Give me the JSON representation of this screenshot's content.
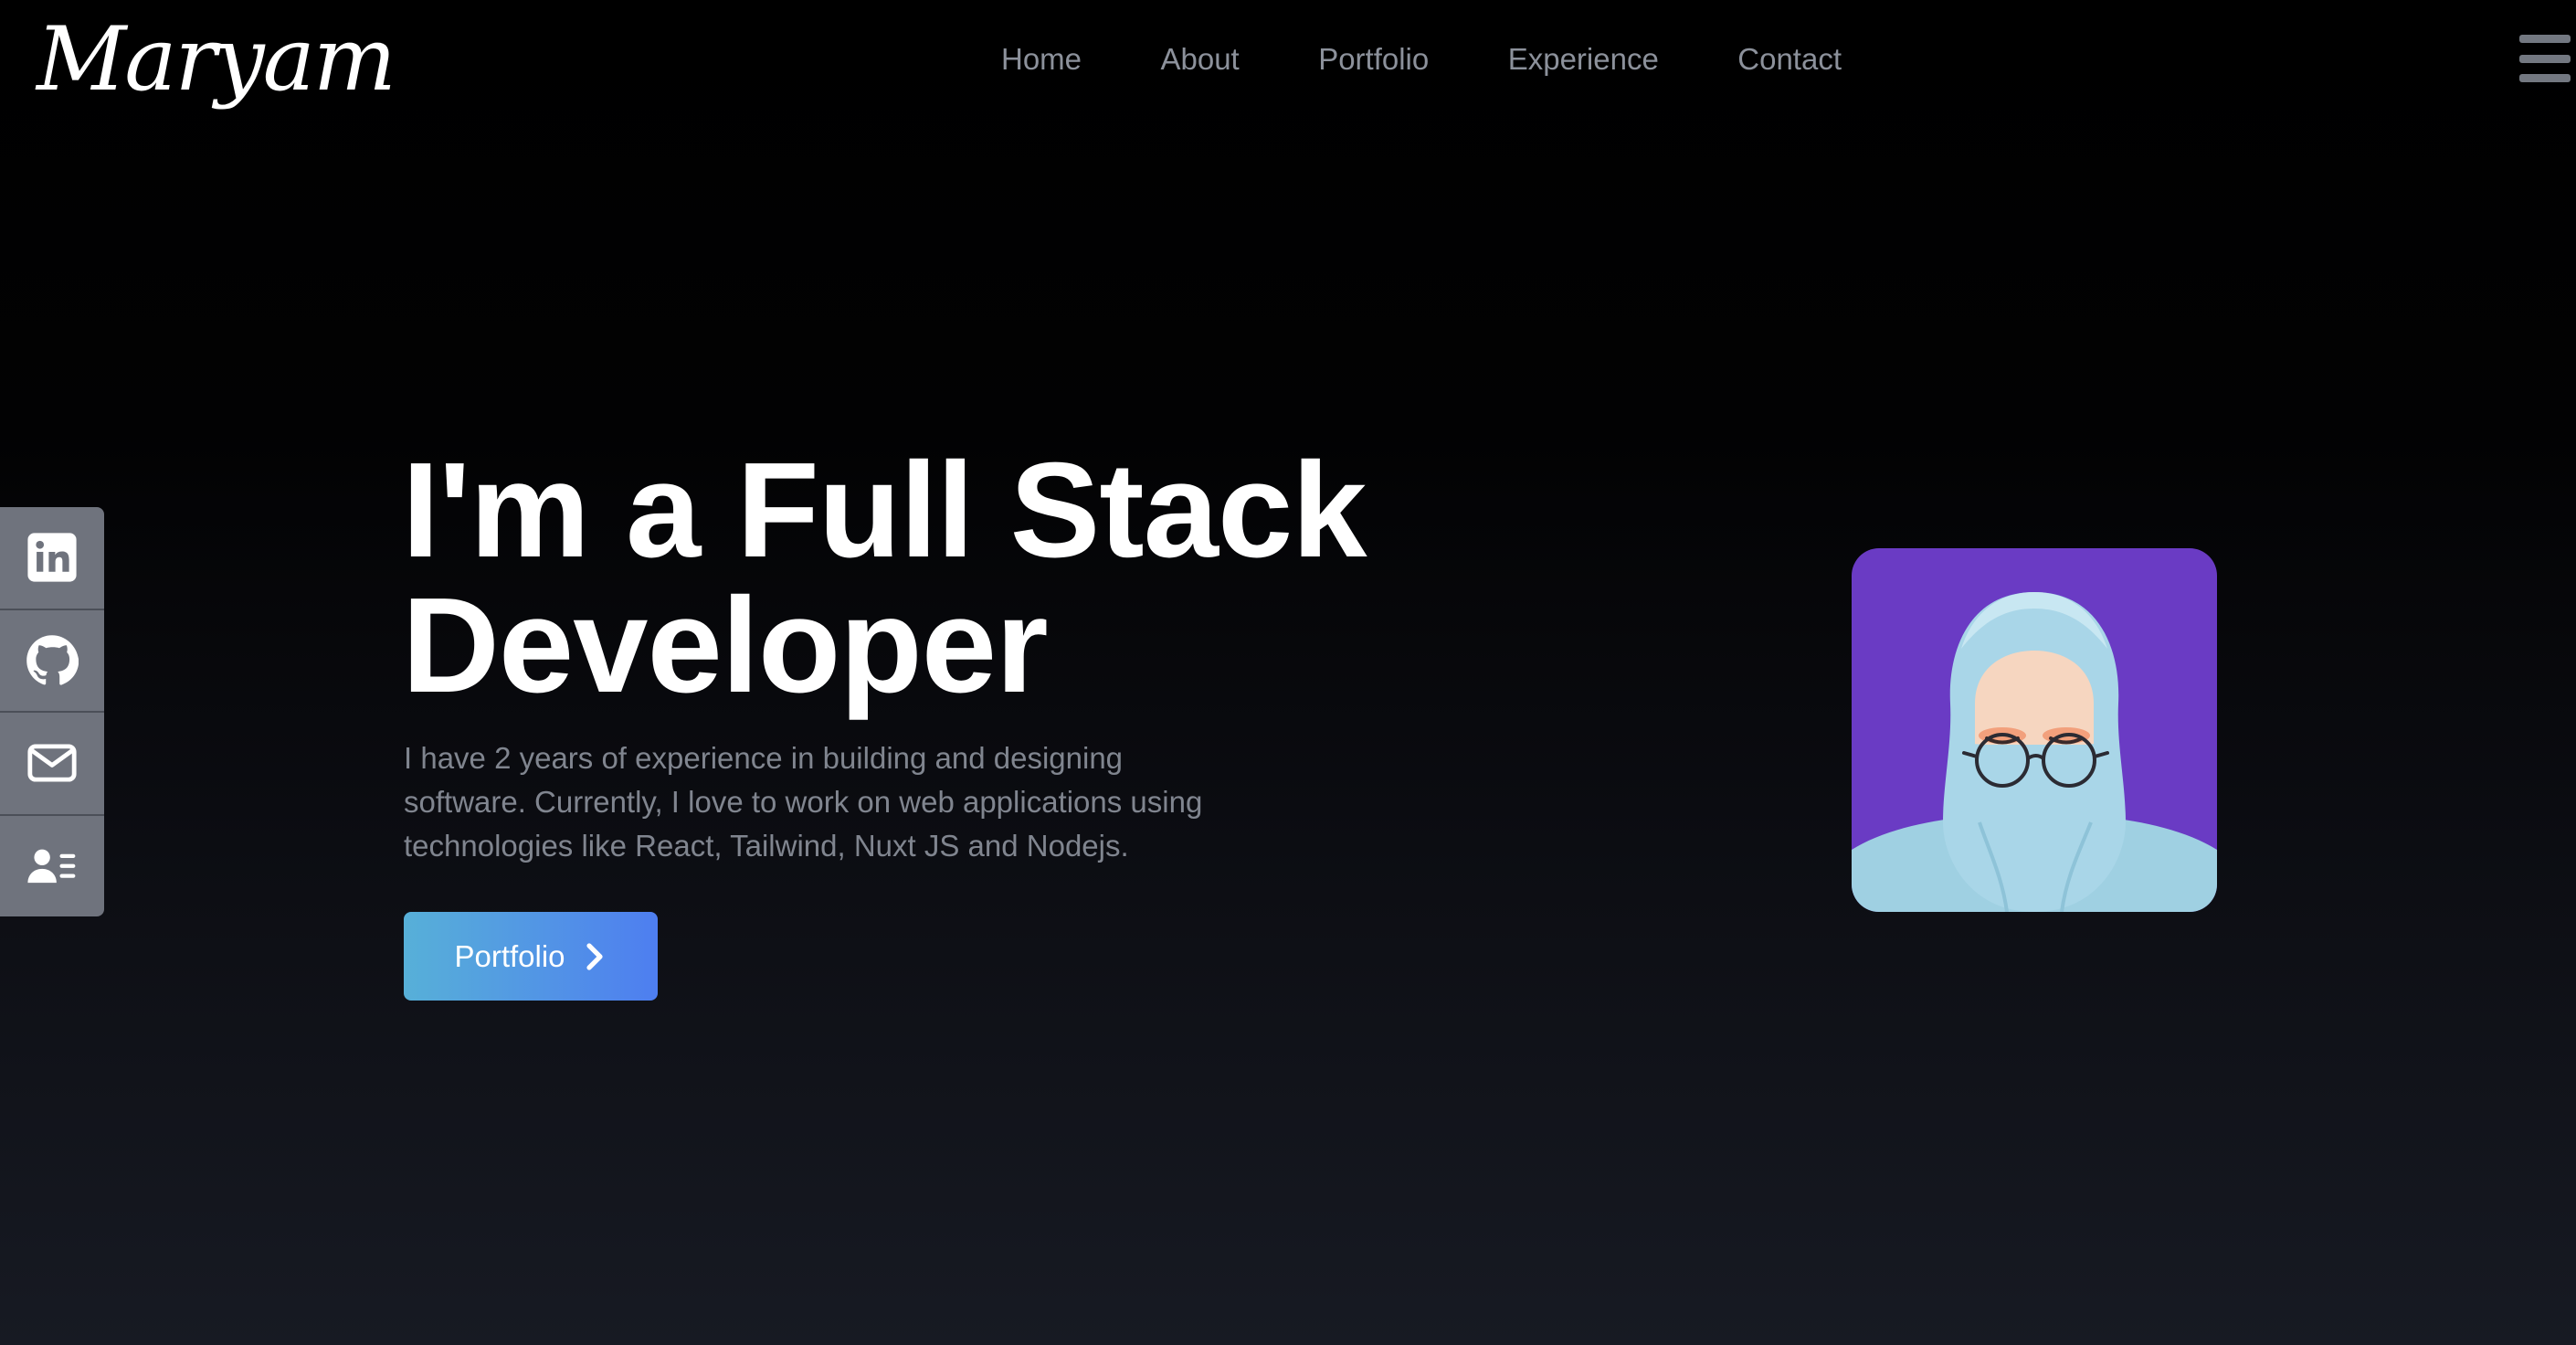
{
  "header": {
    "logo_text": "Maryam",
    "nav": [
      {
        "label": "Home"
      },
      {
        "label": "About"
      },
      {
        "label": "Portfolio"
      },
      {
        "label": "Experience"
      },
      {
        "label": "Contact"
      }
    ],
    "menu_icon": "hamburger-menu-icon"
  },
  "social": [
    {
      "icon": "linkedin-icon"
    },
    {
      "icon": "github-icon"
    },
    {
      "icon": "mail-icon"
    },
    {
      "icon": "resume-icon"
    }
  ],
  "hero": {
    "title_line1": "I'm a Full Stack",
    "title_line2": "Developer",
    "description": "I have 2 years of experience in building and designing software. Currently, I love to work on web applications using technologies like React, Tailwind, Nuxt JS and Nodejs.",
    "cta_label": "Portfolio",
    "cta_icon": "chevron-right-icon"
  },
  "avatar": {
    "background": "#6a3bc4",
    "illustration": "avatar-illustration"
  },
  "colors": {
    "nav_text": "#8c919b",
    "sidebar": "#6f737d",
    "button_start": "#57b0d8",
    "button_end": "#4e7ef0"
  }
}
